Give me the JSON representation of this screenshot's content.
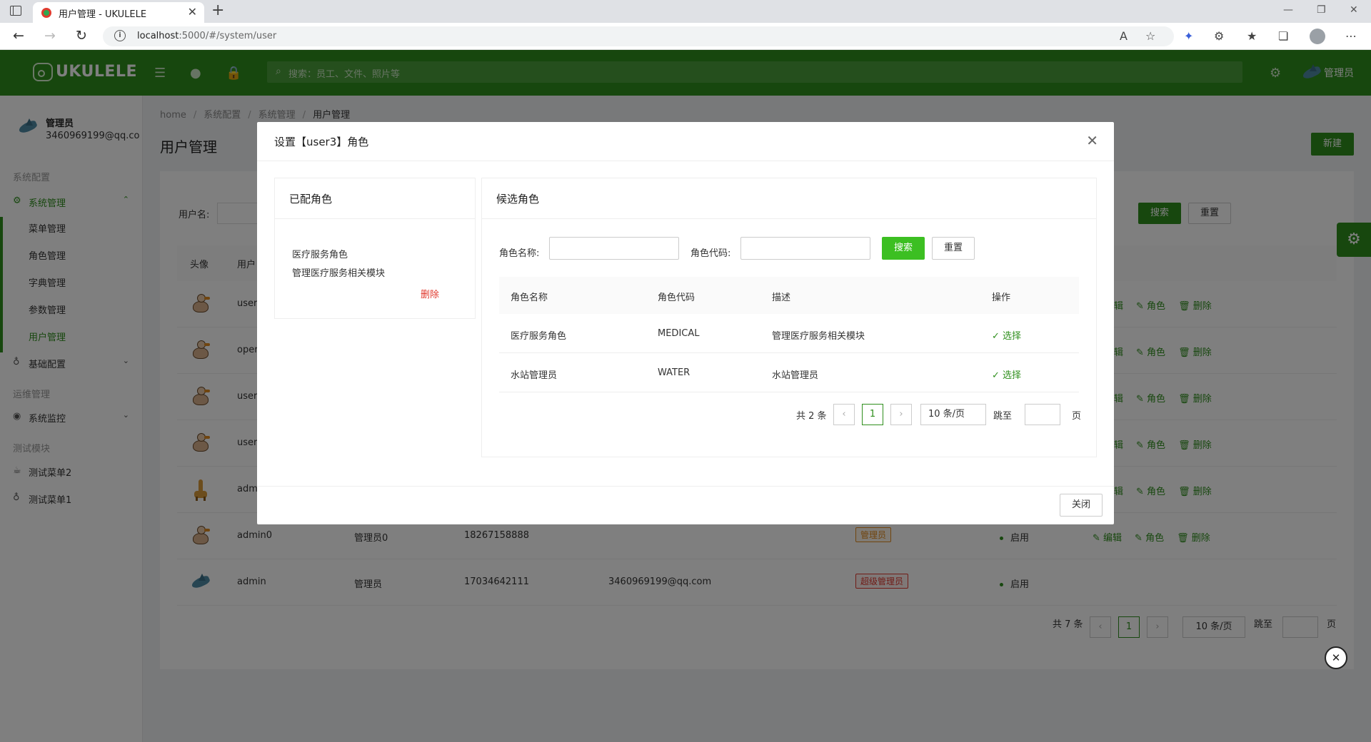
{
  "browser": {
    "tab_title": "用户管理 - UKULELE",
    "url_host": "localhost",
    "url_rest": ":5000/#/system/user"
  },
  "header": {
    "logo_text": "UKULELE",
    "search_placeholder": "搜索：员工、文件、照片等",
    "user_name": "管理员",
    "accent_color": "#2f8f1d"
  },
  "sidebar": {
    "user_name": "管理员",
    "user_email": "3460969199@qq.com",
    "groups": [
      "系统配置",
      "运维管理",
      "测试模块"
    ],
    "system_manage": "系统管理",
    "sub_items": [
      "菜单管理",
      "角色管理",
      "字典管理",
      "参数管理",
      "用户管理"
    ],
    "basic_config": "基础配置",
    "system_monitor": "系统监控",
    "test_menu2": "测试菜单2",
    "test_menu1": "测试菜单1"
  },
  "page": {
    "breadcrumb": [
      "home",
      "系统配置",
      "系统管理",
      "用户管理"
    ],
    "title": "用户管理",
    "new_label": "新建",
    "filter_label": "用户名:",
    "search_label": "搜索",
    "reset_label": "重置",
    "columns": {
      "avatar": "头像",
      "user": "用户"
    },
    "rows": [
      {
        "username": "user",
        "nickname": "",
        "phone": "",
        "email": "",
        "tag": "",
        "status": ""
      },
      {
        "username": "oper",
        "nickname": "",
        "phone": "",
        "email": "",
        "tag": "",
        "status": ""
      },
      {
        "username": "user",
        "nickname": "",
        "phone": "",
        "email": "",
        "tag": "",
        "status": ""
      },
      {
        "username": "user",
        "nickname": "",
        "phone": "",
        "email": "",
        "tag": "",
        "status": ""
      },
      {
        "username": "adm",
        "nickname": "",
        "phone": "",
        "email": "",
        "tag": "",
        "status": ""
      },
      {
        "username": "admin0",
        "nickname": "管理员0",
        "phone": "18267158888",
        "email": "",
        "tag": "管理员",
        "status": "启用"
      },
      {
        "username": "admin",
        "nickname": "管理员",
        "phone": "17034642111",
        "email": "3460969199@qq.com",
        "tag": "超级管理员",
        "status": "启用"
      }
    ],
    "ops": {
      "edit": "编辑",
      "role": "角色",
      "delete": "删除",
      "edit_partial": "辑"
    },
    "pager": {
      "total": "共 7 条",
      "page": "1",
      "size": "10 条/页",
      "jump": "跳至",
      "page_unit": "页"
    }
  },
  "modal": {
    "title": "设置【user3】角色",
    "assigned": {
      "title": "已配角色",
      "name": "医疗服务角色",
      "desc": "管理医疗服务相关模块",
      "delete": "删除"
    },
    "candidates": {
      "title": "候选角色",
      "name_label": "角色名称:",
      "code_label": "角色代码:",
      "search": "搜索",
      "reset": "重置",
      "headers": [
        "角色名称",
        "角色代码",
        "描述",
        "操作"
      ],
      "rows": [
        {
          "name": "医疗服务角色",
          "code": "MEDICAL",
          "desc": "管理医疗服务相关模块",
          "action": "✓ 选择"
        },
        {
          "name": "水站管理员",
          "code": "WATER",
          "desc": "水站管理员",
          "action": "✓ 选择"
        }
      ],
      "pager": {
        "total": "共 2 条",
        "page": "1",
        "size": "10 条/页",
        "jump": "跳至",
        "page_unit": "页"
      }
    },
    "close": "关闭"
  }
}
